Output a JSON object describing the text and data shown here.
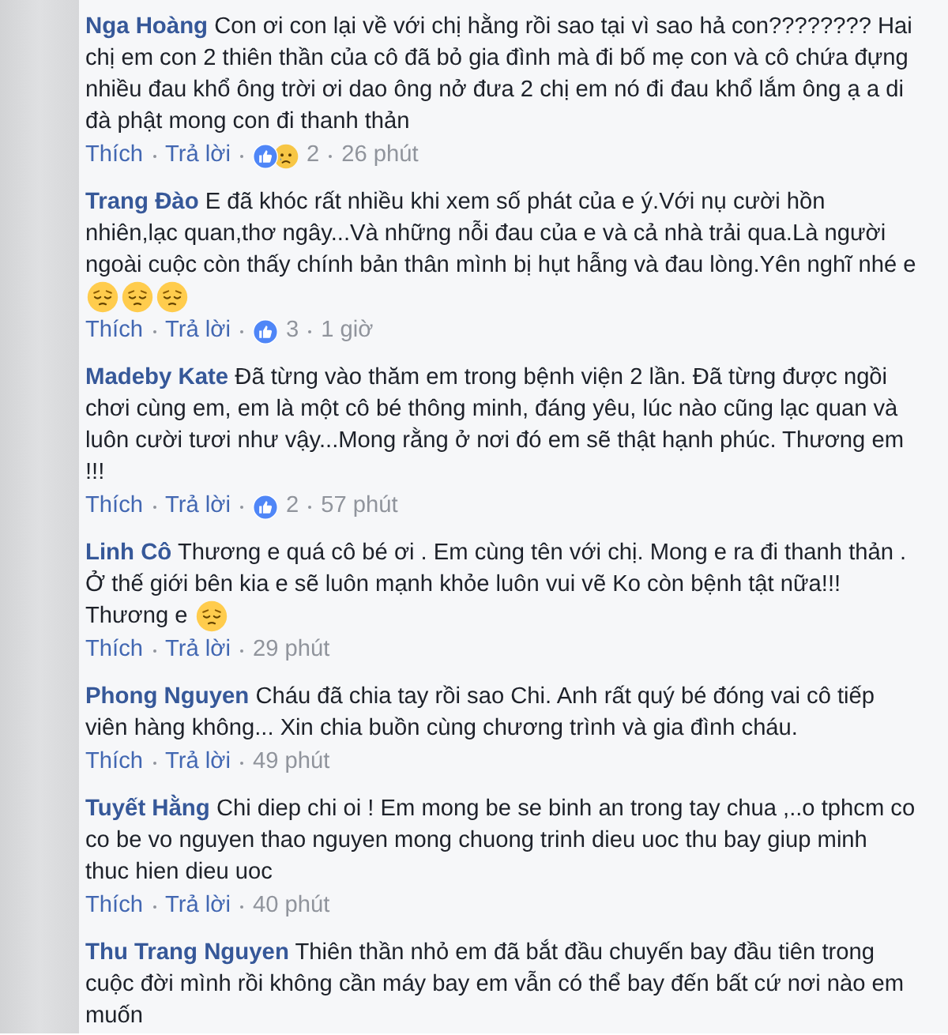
{
  "comments": [
    {
      "author": "Nga Hoàng",
      "text": "Con ơi con lại về với chị hằng rồi sao tại vì sao hả con???????? Hai chị em con 2 thiên thần của cô đã bỏ gia đình mà đi bố mẹ con và cô chứa đựng nhiều đau khổ ông trời ơi dao ông nở đưa 2 chị em nó đi đau khổ lắm ông ạ a di đà phật mong con đi thanh thản",
      "actions": [
        "Thích",
        "Trả lời"
      ],
      "reactions": [
        {
          "kind": "like"
        },
        {
          "kind": "sad"
        }
      ],
      "reaction_count": "2",
      "time": "26 phút"
    },
    {
      "author": "Trang Đào",
      "text": "E đã khóc rất nhiều khi xem số phát của e ý.Với nụ cười hồn nhiên,lạc quan,thơ ngây...Và những nỗi đau của e và cả nhà trải qua.Là người ngoài cuộc còn thấy chính bản thân mình bị hụt hẫng và đau lòng.Yên nghĩ nhé e",
      "emojis": [
        {
          "kind": "pensive"
        },
        {
          "kind": "pensive"
        },
        {
          "kind": "pensive"
        }
      ],
      "actions": [
        "Thích",
        "Trả lời"
      ],
      "reactions": [
        {
          "kind": "like"
        }
      ],
      "reaction_count": "3",
      "time": "1 giờ"
    },
    {
      "author": "Madeby Kate",
      "text": "Đã từng vào thăm em trong bệnh viện 2 lần. Đã từng được ngồi chơi cùng em, em là một cô bé thông minh, đáng yêu, lúc nào cũng lạc quan và luôn cười tươi như vậy...Mong rằng ở nơi đó em sẽ thật hạnh phúc. Thương em !!!",
      "actions": [
        "Thích",
        "Trả lời"
      ],
      "reactions": [
        {
          "kind": "like"
        }
      ],
      "reaction_count": "2",
      "time": "57 phút"
    },
    {
      "author": "Linh Cô",
      "text": "Thương e quá cô bé ơi . Em cùng tên với chị. Mong e ra đi thanh thản . Ở thế giới bên kia e sẽ luôn mạnh khỏe luôn vui vẽ Ko còn bệnh tật nữa!!! Thương e",
      "emojis": [
        {
          "kind": "pensive"
        }
      ],
      "actions": [
        "Thích",
        "Trả lời"
      ],
      "time": "29 phút"
    },
    {
      "author": "Phong Nguyen",
      "text": "Cháu đã chia tay rồi sao Chi. Anh rất quý bé đóng vai cô tiếp viên hàng không... Xin chia buồn cùng chương trình và gia đình cháu.",
      "actions": [
        "Thích",
        "Trả lời"
      ],
      "time": "49 phút"
    },
    {
      "author": "Tuyết Hằng",
      "text": "Chi diep chi oi ! Em mong be se binh an trong tay chua ,..o tphcm co co be vo nguyen thao nguyen mong chuong trinh dieu uoc thu bay giup minh thuc hien dieu uoc",
      "actions": [
        "Thích",
        "Trả lời"
      ],
      "time": "40 phút"
    },
    {
      "author": "Thu Trang Nguyen",
      "text": "Thiên thần nhỏ em đã bắt đầu chuyến bay đầu tiên trong cuộc đời mình rồi không cần máy bay em vẫn có thể bay đến bất cứ nơi nào em muốn"
    }
  ]
}
